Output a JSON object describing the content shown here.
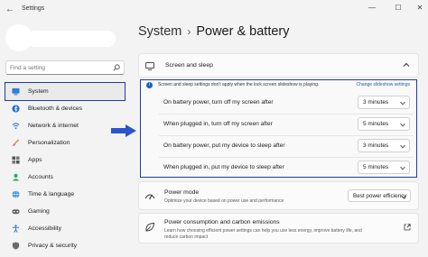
{
  "window": {
    "title": "Settings",
    "back_glyph": "←",
    "minimize_glyph": "—",
    "maximize_glyph": "☐",
    "close_glyph": "✕"
  },
  "search": {
    "placeholder": "Find a setting"
  },
  "sidebar": {
    "items": [
      {
        "label": "System",
        "icon": "system-icon",
        "active": true
      },
      {
        "label": "Bluetooth & devices",
        "icon": "bluetooth-icon"
      },
      {
        "label": "Network & internet",
        "icon": "wifi-icon"
      },
      {
        "label": "Personalization",
        "icon": "brush-icon"
      },
      {
        "label": "Apps",
        "icon": "apps-icon"
      },
      {
        "label": "Accounts",
        "icon": "accounts-icon"
      },
      {
        "label": "Time & language",
        "icon": "globe-icon"
      },
      {
        "label": "Gaming",
        "icon": "gaming-icon"
      },
      {
        "label": "Accessibility",
        "icon": "accessibility-icon"
      },
      {
        "label": "Privacy & security",
        "icon": "shield-icon"
      }
    ]
  },
  "header": {
    "crumb": "System",
    "separator": "›",
    "title": "Power & battery"
  },
  "screen_sleep": {
    "title": "Screen and sleep",
    "info_text": "Screen and sleep settings don't apply when the lock screen slideshow is playing.",
    "info_link": "Change slideshow settings",
    "rows": [
      {
        "label": "On battery power, turn off my screen after",
        "value": "3 minutes"
      },
      {
        "label": "When plugged in, turn off my screen after",
        "value": "5 minutes"
      },
      {
        "label": "On battery power, put my device to sleep after",
        "value": "3 minutes"
      },
      {
        "label": "When plugged in, put my device to sleep after",
        "value": "5 minutes"
      }
    ]
  },
  "power_mode": {
    "title": "Power mode",
    "description": "Optimize your device based on power use and performance",
    "value": "Best power efficiency"
  },
  "carbon": {
    "title": "Power consumption and carbon emissions",
    "description": "Learn how choosing efficient power settings can help you use less energy, improve battery life, and reduce carbon impact"
  },
  "colors": {
    "accent": "#1f3f96",
    "arrow": "#2b55c9",
    "link": "#1a5fb4"
  }
}
